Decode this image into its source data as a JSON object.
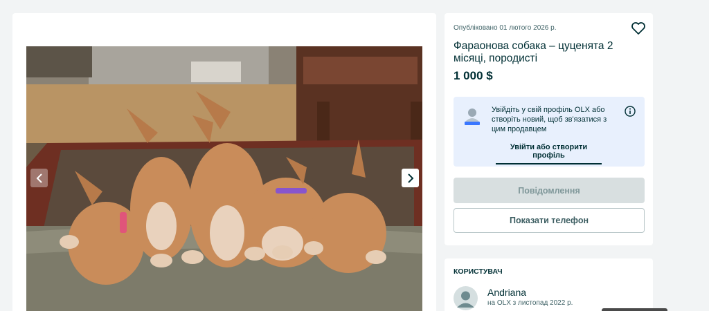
{
  "gallery": {
    "photo_alt": "puppies-photo",
    "prev_icon": "chevron-left-icon",
    "next_icon": "chevron-right-icon"
  },
  "listing": {
    "published": "Опубліковано 01 лютого 2026 р.",
    "title": "Фараонова собака – цуценята 2 місяці, породисті",
    "price": "1 000 $",
    "favorite_icon": "heart-icon"
  },
  "login_prompt": {
    "text": "Увійдіть у свій профіль OLX або створіть новий, щоб зв'язатися з цим продавцем",
    "link": "Увійти або створити профіль",
    "info_icon": "info-icon"
  },
  "actions": {
    "message": "Повідомлення",
    "phone": "Показати телефон"
  },
  "user": {
    "section_title": "КОРИСТУВАЧ",
    "name": "Andriana",
    "since": "на OLX з листопад 2022 р."
  },
  "colors": {
    "background": "#f2f4f5",
    "text_primary": "#002f34",
    "login_box": "#e8f0fd",
    "disabled_button": "#d8dfe0"
  }
}
